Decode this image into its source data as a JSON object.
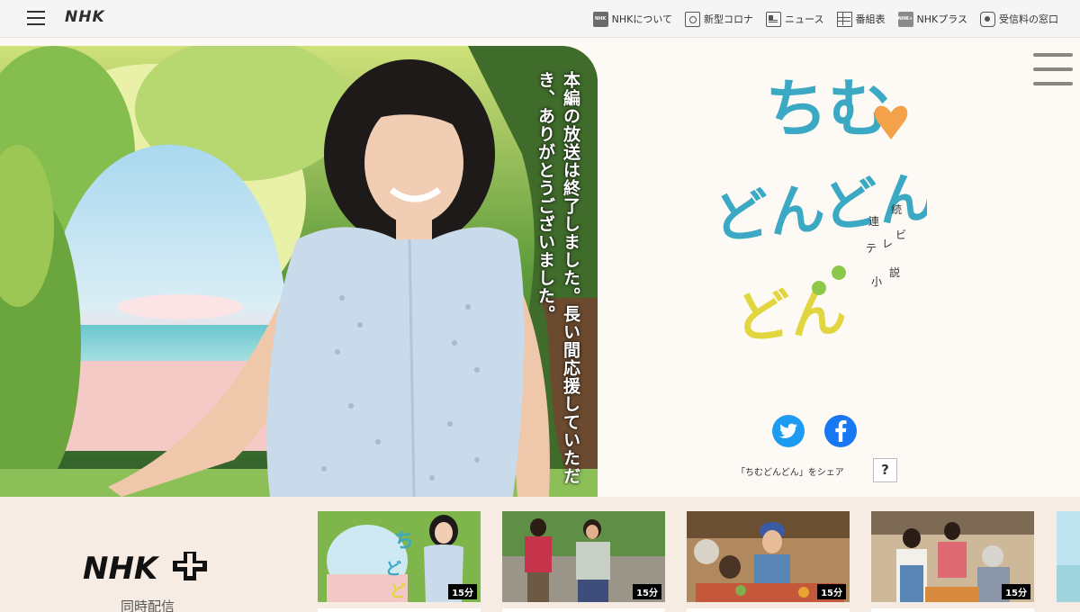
{
  "header": {
    "logo": "NHK",
    "nav": [
      {
        "label": "NHKについて",
        "icon": "nhk-about-icon"
      },
      {
        "label": "新型コロナ",
        "icon": "corona-icon"
      },
      {
        "label": "ニュース",
        "icon": "news-icon"
      },
      {
        "label": "番組表",
        "icon": "program-guide-icon"
      },
      {
        "label": "NHKプラス",
        "icon": "nhk-plus-icon"
      },
      {
        "label": "受信料の窓口",
        "icon": "reception-fee-icon"
      }
    ]
  },
  "hero": {
    "message": "本編の放送は終了しました。長い間応援していただき、ありがとうございました。",
    "title_line1": "ちむ",
    "title_line2": "どんどん",
    "series_label": "連続テレビ小説"
  },
  "share": {
    "text": "「ちむどんどん」をシェア",
    "help": "?"
  },
  "nhkplus": {
    "logo": "NHK",
    "simulcast": "同時配信"
  },
  "episodes": [
    {
      "duration": "15分"
    },
    {
      "duration": "15分"
    },
    {
      "duration": "15分"
    },
    {
      "duration": "15分"
    }
  ],
  "colors": {
    "twitter": "#1d9bf0",
    "facebook": "#1877f2",
    "title_teal": "#3ba8c4",
    "title_yellow": "#e2d640"
  }
}
